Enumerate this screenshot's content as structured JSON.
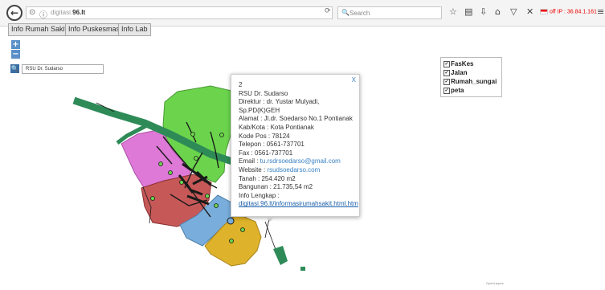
{
  "browser": {
    "url_host": "digitasi.",
    "url_bold": "96.lt",
    "search_placeholder": "Search",
    "ip_text": "off IP : 36.84.1.161"
  },
  "nav": {
    "buttons": [
      "Info Rumah Sakit",
      "Info Puskesmas",
      "Info Lab"
    ]
  },
  "map_controls": {
    "zoom_in": "+",
    "zoom_out": "−",
    "search_value": "RSU Dr. Sudarso"
  },
  "layers": [
    {
      "label": "FasKes",
      "checked": true
    },
    {
      "label": "Jalan",
      "checked": true
    },
    {
      "label": "Rumah_sungai",
      "checked": true
    },
    {
      "label": "peta",
      "checked": true
    }
  ],
  "popup": {
    "close": "X",
    "id": "2",
    "name": "RSU Dr. Sudarso",
    "direktur": "Direktur : dr. Yustar Mulyadi,",
    "direktur2": "Sp.PD(K)GEH",
    "alamat": "Alamat : Jl.dr. Soedarso No.1 Pontianak",
    "kota": "Kab/Kota : Kota Pontianak",
    "kodepos": "Kode Pos : 78124",
    "telepon": "Telepon : 0561-737701",
    "fax": "Fax : 0561-737701",
    "email_label": "Email : ",
    "email": "tu.rsdrsoedarso@gmail.com",
    "website_label": "Website : ",
    "website": "rsudsoedarso.com",
    "tanah": "Tanah : 254.420 m2",
    "bangunan": "Bangunan : 21.735,54 m2",
    "info_label": "Info Lengkap :",
    "info_link": "digitasi.96.lt/informasirumahsakit.html.htm"
  },
  "colors": {
    "green": "#6bd44c",
    "pink": "#de79d8",
    "red": "#c65858",
    "blue": "#79aedc",
    "yellow": "#deb22a",
    "river": "#2e8b57",
    "road": "#1a1a1a"
  },
  "footer": {
    "credit": "OpenLayers"
  }
}
